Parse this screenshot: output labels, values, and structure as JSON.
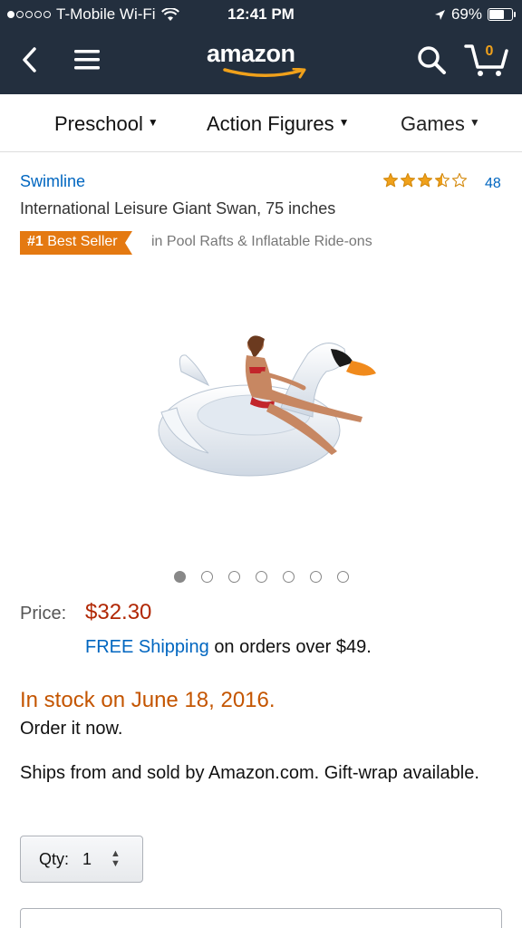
{
  "status_bar": {
    "carrier": "T-Mobile Wi-Fi",
    "time": "12:41 PM",
    "battery_text": "69%",
    "battery_level": 0.69,
    "signal_dots_filled": 1,
    "signal_dots_total": 5
  },
  "header": {
    "logo_text": "amazon",
    "cart_count": "0",
    "background": "#232f3e",
    "accent": "#f0a11b"
  },
  "categories": [
    {
      "label": "Preschool"
    },
    {
      "label": "Action Figures"
    },
    {
      "label": "Games"
    }
  ],
  "product": {
    "brand": "Swimline",
    "rating_stars": 3.5,
    "rating_count": "48",
    "title": "International Leisure Giant Swan, 75 inches",
    "badge_rank": "#1",
    "badge_text": "Best Seller",
    "badge_category": "in Pool Rafts & Inflatable Ride-ons",
    "image_icon": "swan-float-image",
    "image_count": 7,
    "image_index": 0
  },
  "pricing": {
    "price_label": "Price:",
    "price": "$32.30",
    "shipping_link": "FREE Shipping",
    "shipping_rest": "on orders over $49."
  },
  "availability": {
    "stock": "In stock on June 18, 2016.",
    "order": "Order it now.",
    "ships": "Ships from and sold by Amazon.com. Gift-wrap available."
  },
  "quantity": {
    "label": "Qty:",
    "value": "1"
  }
}
